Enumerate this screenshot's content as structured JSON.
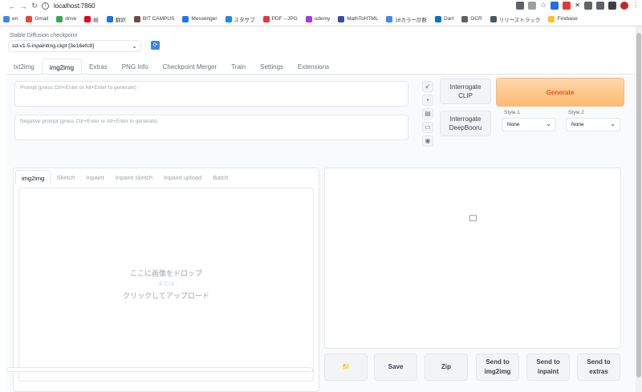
{
  "browser": {
    "url": "localhost:7860",
    "bookmarks": [
      {
        "label": "en",
        "icon": "google-icon",
        "color": "#4285f4"
      },
      {
        "label": "Gmail",
        "icon": "gmail-icon",
        "color": "#ea4335"
      },
      {
        "label": "drive",
        "icon": "drive-icon",
        "color": "#34a853"
      },
      {
        "label": "絵",
        "icon": "pinterest-icon",
        "color": "#e60023"
      },
      {
        "label": "翻訳",
        "icon": "translate-icon",
        "color": "#1a73e8"
      },
      {
        "label": "BIT CAMPUS",
        "icon": "bitcampus-icon",
        "color": "#6d4c41"
      },
      {
        "label": "Messenger",
        "icon": "facebook-icon",
        "color": "#1877f2"
      },
      {
        "label": "スタサプ",
        "icon": "stasapu-icon",
        "color": "#1e88e5"
      },
      {
        "label": "PDF→JPG",
        "icon": "pdf-icon",
        "color": "#e53935"
      },
      {
        "label": "udemy",
        "icon": "udemy-icon",
        "color": "#a435f0"
      },
      {
        "label": "MathToHTML",
        "icon": "math-icon",
        "color": "#3949ab"
      },
      {
        "label": "16カラー診断",
        "icon": "google-icon",
        "color": "#4285f4"
      },
      {
        "label": "Dart",
        "icon": "dart-icon",
        "color": "#0175c2"
      },
      {
        "label": "OCR",
        "icon": "ocr-icon",
        "color": "#616161"
      },
      {
        "label": "リリーストラック",
        "icon": "release-icon",
        "color": "#455a64"
      },
      {
        "label": "Firebase",
        "icon": "folder-icon",
        "color": "#fbc02d"
      }
    ]
  },
  "checkpoint": {
    "label": "Stable Diffusion checkpoint",
    "value": "sd-v1-5-inpainting.ckpt [3e16efc8]"
  },
  "tabs": [
    "txt2img",
    "img2img",
    "Extras",
    "PNG Info",
    "Checkpoint Merger",
    "Train",
    "Settings",
    "Extensions"
  ],
  "active_tab": "img2img",
  "prompt": {
    "placeholder": "Prompt (press Ctrl+Enter or Alt+Enter to generate)"
  },
  "negative_prompt": {
    "placeholder": "Negative prompt (press Ctrl+Enter or Alt+Enter to generate)"
  },
  "buttons": {
    "interrogate_clip": "Interrogate CLIP",
    "interrogate_deepbooru": "Interrogate DeepBooru",
    "generate": "Generate"
  },
  "styles": {
    "style1_label": "Style 1",
    "style1_value": "None",
    "style2_label": "Style 2",
    "style2_value": "None"
  },
  "sub_tabs": [
    "img2img",
    "Sketch",
    "Inpaint",
    "Inpaint sketch",
    "Inpaint upload",
    "Batch"
  ],
  "drop_zone": {
    "line1": "ここに画像をドロップ",
    "line2": "- または -",
    "line3": "クリックしてアップロード"
  },
  "output_actions": {
    "folder": "📁",
    "save": "Save",
    "zip": "Zip",
    "send_img2img": "Send to img2img",
    "send_inpaint": "Send to inpaint",
    "send_extras": "Send to extras"
  },
  "colors": {
    "generate_bg": "#fdba74",
    "generate_text": "#ea580c",
    "refresh_bg": "#3b82f6"
  }
}
